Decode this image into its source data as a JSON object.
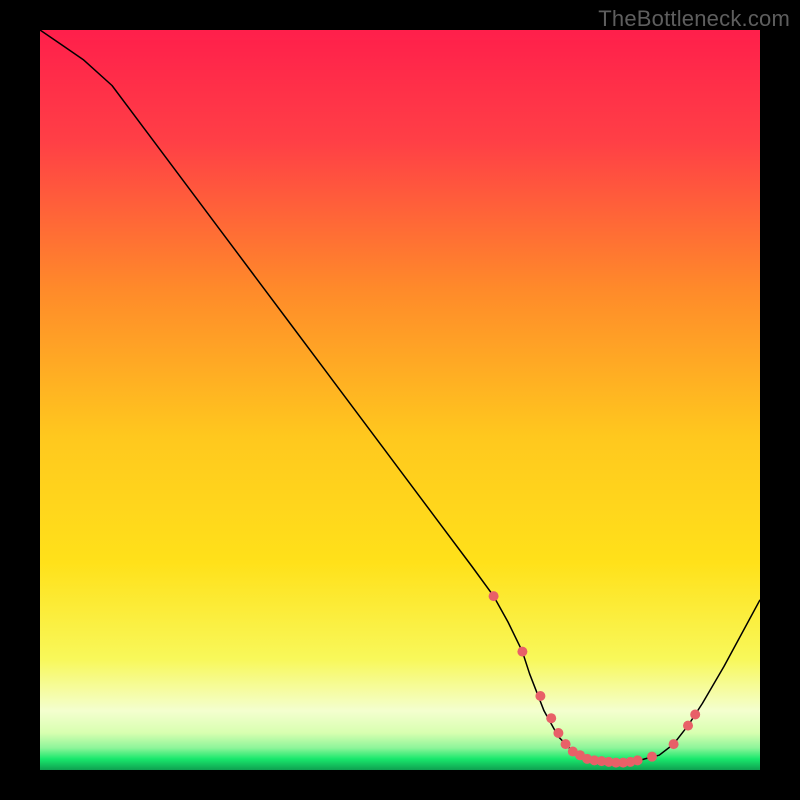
{
  "watermark": "TheBottleneck.com",
  "chart_data": {
    "type": "line",
    "xlim": [
      0,
      100
    ],
    "ylim": [
      0,
      100
    ],
    "grid": false,
    "legend": false,
    "background_gradient": {
      "top_color": "#ff1f4b",
      "mid_color": "#ffe11a",
      "bottom_accent": "#19e86c",
      "bottom_pale": "#f4ffcf"
    },
    "series": [
      {
        "name": "curve",
        "color": "#000000",
        "width": 1.5,
        "x": [
          0,
          3,
          6,
          10,
          15,
          20,
          25,
          30,
          35,
          40,
          45,
          50,
          55,
          60,
          63,
          65,
          67,
          68,
          69,
          70,
          72,
          74,
          76,
          78,
          80,
          82,
          83,
          84,
          86,
          88,
          90,
          92,
          95,
          100
        ],
        "y": [
          100,
          98,
          96,
          92.5,
          86,
          79.5,
          73,
          66.5,
          60,
          53.5,
          47,
          40.5,
          34,
          27.5,
          23.5,
          20,
          16,
          13,
          10.5,
          8,
          4.5,
          2.5,
          1.5,
          1,
          1,
          1,
          1.2,
          1.5,
          2,
          3.5,
          6,
          9,
          14,
          23
        ]
      }
    ],
    "markers": {
      "name": "highlight-points",
      "color": "#e86068",
      "radius": 5,
      "x": [
        63,
        67,
        69.5,
        71,
        72,
        73,
        74,
        75,
        76,
        77,
        78,
        79,
        80,
        81,
        82,
        83,
        85,
        88,
        90,
        91
      ],
      "y": [
        23.5,
        16,
        10,
        7,
        5,
        3.5,
        2.5,
        2,
        1.5,
        1.3,
        1.2,
        1.1,
        1,
        1,
        1.1,
        1.3,
        1.8,
        3.5,
        6,
        7.5
      ]
    }
  }
}
